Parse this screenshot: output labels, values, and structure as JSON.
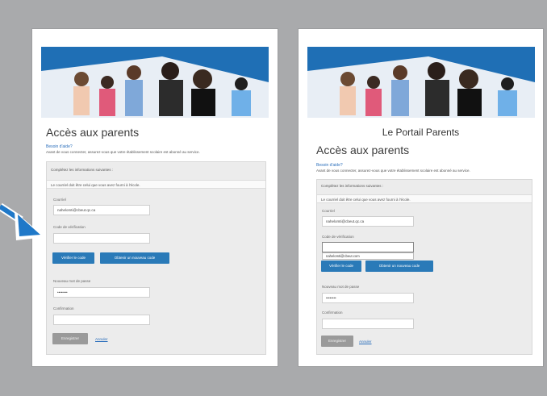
{
  "left": {
    "heading": "Accès aux parents",
    "help_link": "Besoin d'aide?",
    "help_text": "Avant de vous connecter, assurez-vous que votre établissement scolaire est abonné au service.",
    "instructions": "Complétez les informations suivantes :",
    "note": "Le courriel doit être celui que vous avez fourni à l'école.",
    "email_label": "Courriel",
    "email_value": "nahelomti@cbeut.qc.ca",
    "code_label": "Code de vérification",
    "verify_button": "Vérifier le code",
    "new_code_button": "Obtenir un nouveau code",
    "password_label": "Nouveau mot de passe",
    "password_value": "••••••••",
    "confirm_label": "Confirmation",
    "save_button": "Enregistrer",
    "cancel_link": "Annuler"
  },
  "right": {
    "portal_title": "Le Portail Parents",
    "heading": "Accès aux parents",
    "help_link": "Besoin d'aide?",
    "help_text": "Avant de vous connecter, assurez-vous que votre établissement scolaire est abonné au service.",
    "instructions": "Complétez les informations suivantes :",
    "note": "Le courriel doit être celui que vous avez fourni à l'école.",
    "email_label": "Courriel",
    "email_value": "nahelomti@cbeut.qc.ca",
    "code_label": "Code de vérification",
    "autocomplete_suggestion": "nahelomti@cbeut.com",
    "verify_button": "Vérifier le code",
    "new_code_button": "Obtenir un nouveau code",
    "password_label": "Nouveau mot de passe",
    "password_value": "••••••••",
    "confirm_label": "Confirmation",
    "save_button": "Enregistrer",
    "cancel_link": "Annuler"
  },
  "colors": {
    "background": "#a9aaac",
    "accent_blue": "#2a7ab8",
    "banner_blue": "#1f6fb5"
  },
  "icons": [
    "pointer-arrow-icon"
  ]
}
